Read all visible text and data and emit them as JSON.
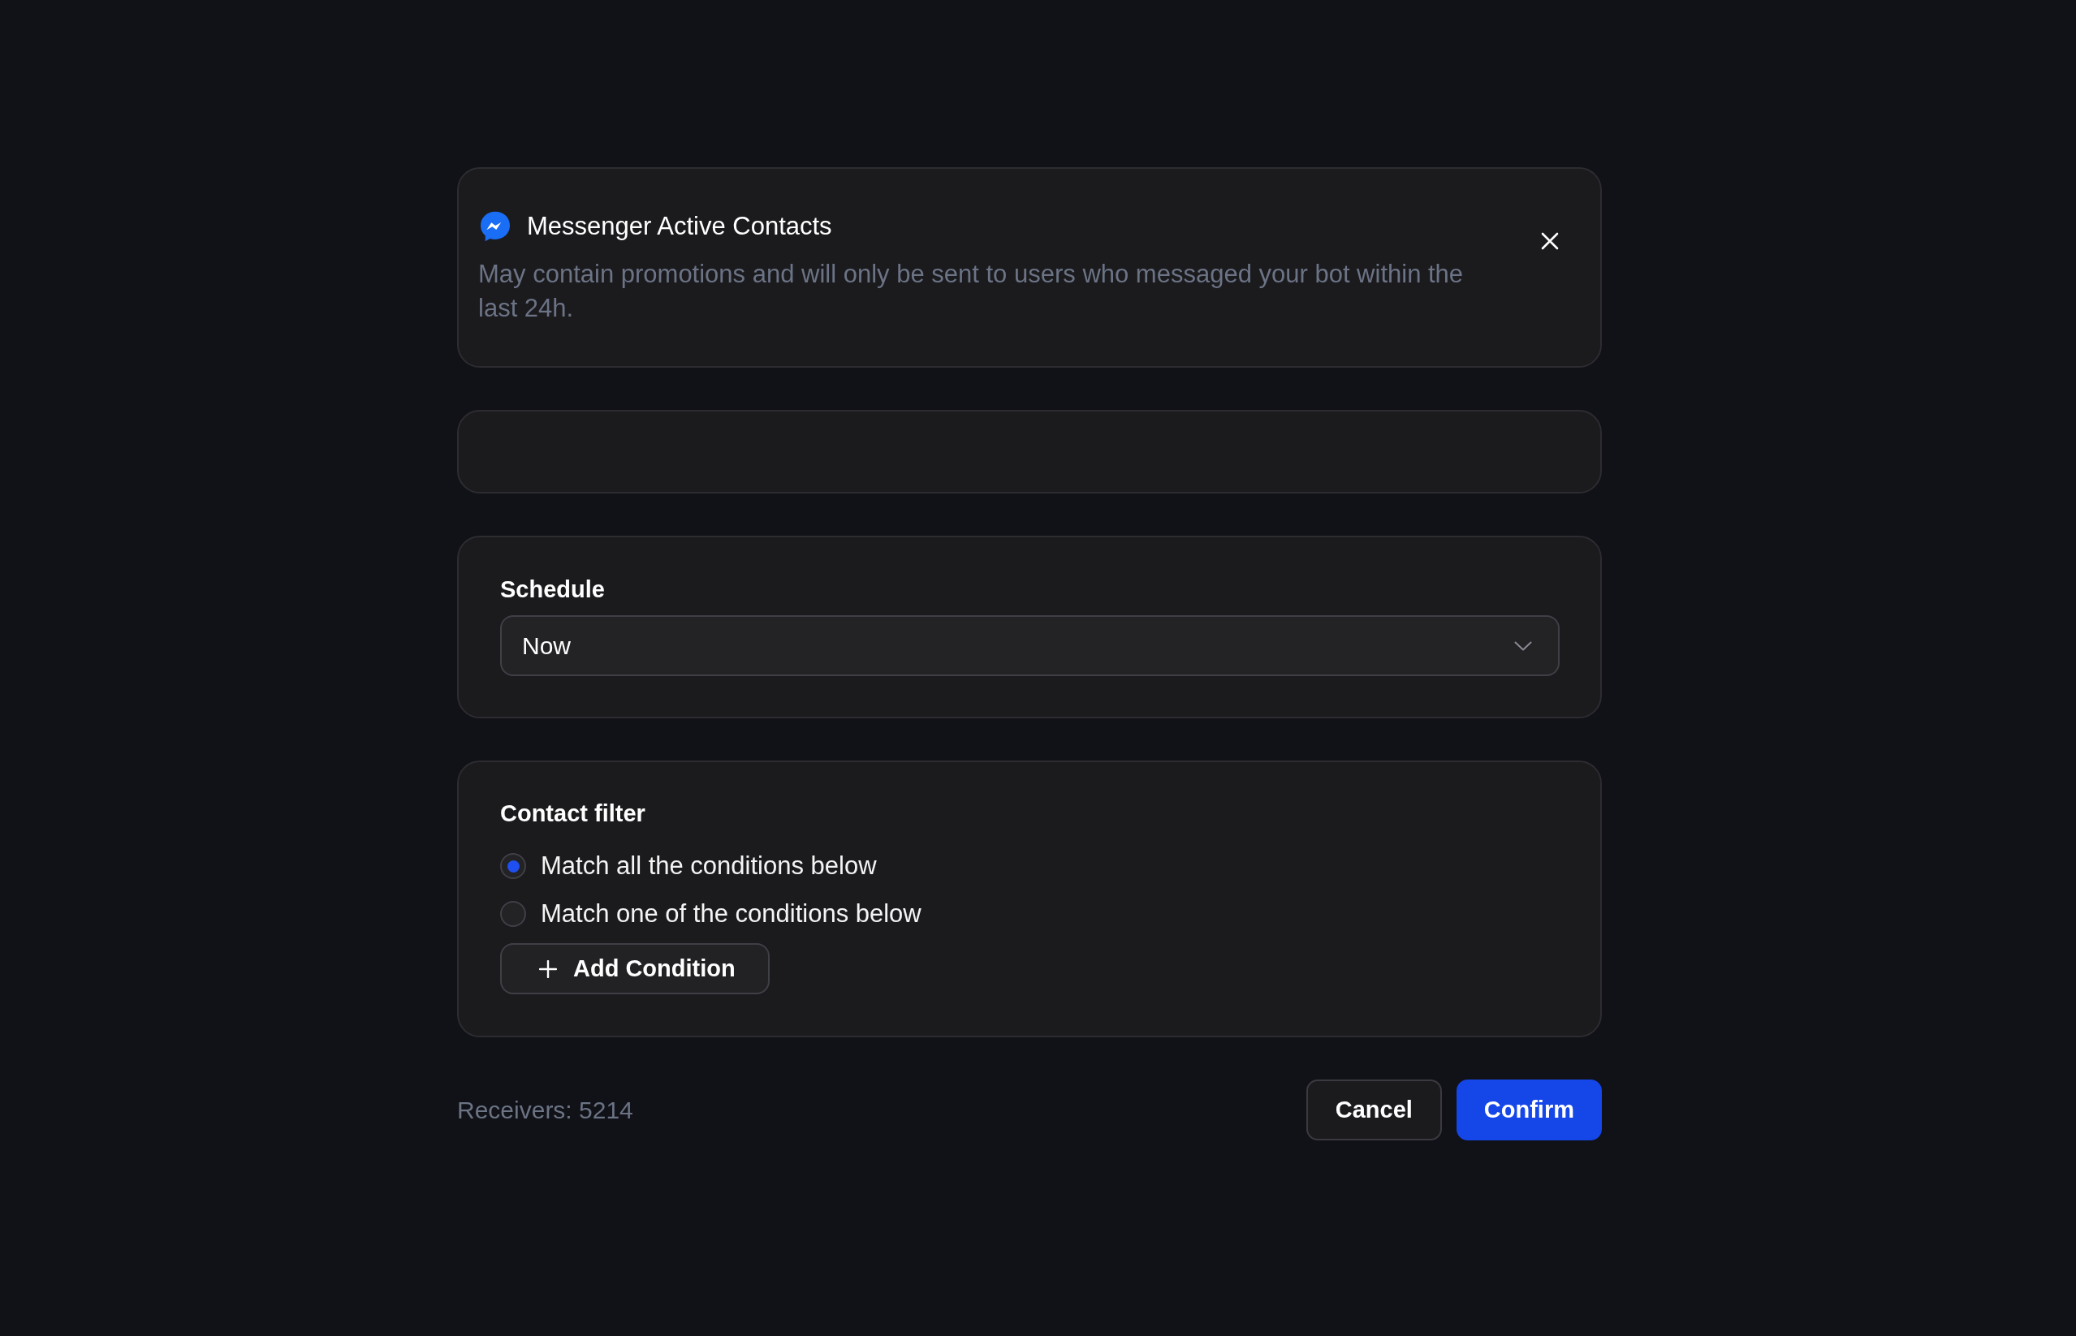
{
  "panel": {
    "title": "Messenger Active Contacts",
    "description": "May contain promotions and will only be sent to users who messaged your bot within the last 24h."
  },
  "schedule": {
    "label": "Schedule",
    "value": "Now"
  },
  "contact_filter": {
    "label": "Contact filter",
    "options": [
      {
        "label": "Match all the conditions below",
        "selected": true
      },
      {
        "label": "Match one of the conditions below",
        "selected": false
      }
    ],
    "add_button": "Add Condition"
  },
  "footer": {
    "receivers": "Receivers: 5214",
    "buttons": [
      {
        "label": "Cancel",
        "kind": "secondary"
      },
      {
        "label": "Confirm",
        "kind": "primary"
      }
    ]
  }
}
